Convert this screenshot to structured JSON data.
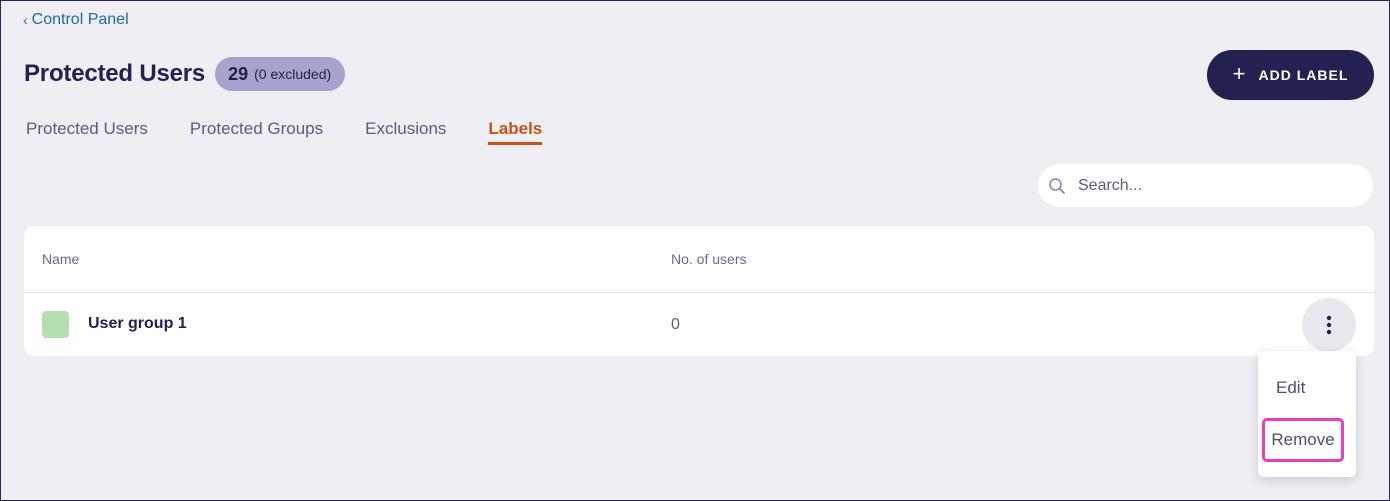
{
  "breadcrumb": {
    "chevron": "‹",
    "label": "Control Panel"
  },
  "header": {
    "title": "Protected Users",
    "count": "29",
    "count_sub": "(0 excluded)",
    "add_button_label": "ADD LABEL"
  },
  "tabs": [
    {
      "label": "Protected Users",
      "active": false
    },
    {
      "label": "Protected Groups",
      "active": false
    },
    {
      "label": "Exclusions",
      "active": false
    },
    {
      "label": "Labels",
      "active": true
    }
  ],
  "search": {
    "placeholder": "Search...",
    "value": ""
  },
  "table": {
    "columns": [
      "Name",
      "No. of users"
    ],
    "rows": [
      {
        "color": "#b5dfb0",
        "name": "User group 1",
        "users": "0"
      }
    ]
  },
  "row_menu": {
    "items": [
      {
        "label": "Edit",
        "highlighted": false
      },
      {
        "label": "Remove",
        "highlighted": true
      }
    ]
  },
  "colors": {
    "primary": "#232150",
    "accent_tab": "#c4531c",
    "highlight": "#e93fbf",
    "badge_bg": "#a6a3cf",
    "page_bg": "#efeef3"
  }
}
